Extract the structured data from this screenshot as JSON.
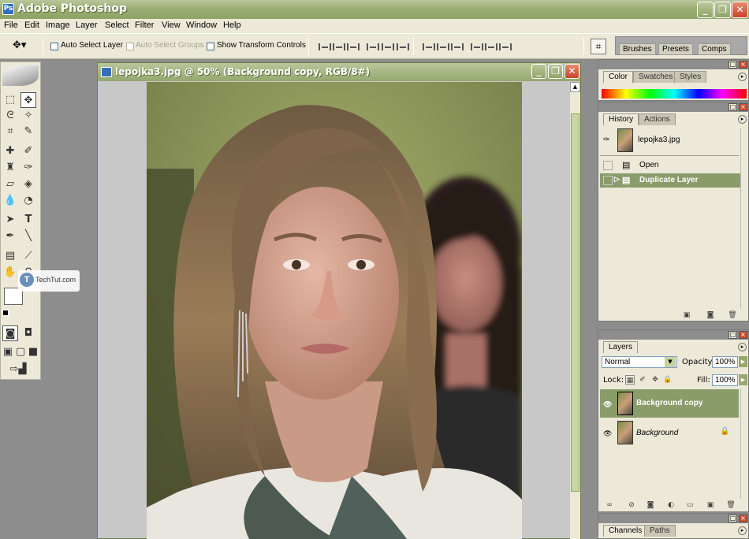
{
  "app": {
    "title": "Adobe Photoshop",
    "icon": "photoshop-app-icon",
    "window_buttons": [
      "_",
      "❐",
      "✕"
    ]
  },
  "menu": [
    "File",
    "Edit",
    "Image",
    "Layer",
    "Select",
    "Filter",
    "View",
    "Window",
    "Help"
  ],
  "options_bar": {
    "auto_select_layer": "Auto Select Layer",
    "auto_select_groups": "Auto Select Groups",
    "show_transform_controls": "Show Transform Controls",
    "palette_well_tabs": [
      "Brushes",
      "Presets",
      "Comps"
    ]
  },
  "watermark": {
    "logo_letter": "T",
    "text": "TechTut.com"
  },
  "document": {
    "title": "lepojka3.jpg @ 50% (Background copy, RGB/8#)"
  },
  "color_panel": {
    "tabs": [
      "Color",
      "Swatches",
      "Styles"
    ]
  },
  "history_panel": {
    "tabs": [
      "History",
      "Actions"
    ],
    "snapshot": "lepojka3.jpg",
    "items": [
      "Open",
      "Duplicate Layer"
    ]
  },
  "layers_panel": {
    "tabs": [
      "Layers"
    ],
    "blend_mode": "Normal",
    "opacity_label": "Opacity:",
    "opacity": "100%",
    "lock_label": "Lock:",
    "fill_label": "Fill:",
    "fill": "100%",
    "layers": [
      "Background copy",
      "Background"
    ]
  },
  "channels_panel": {
    "tabs": [
      "Channels",
      "Paths"
    ]
  },
  "colors": {
    "title_bar": "#98ab72",
    "selected_row": "#8a9c6a",
    "chrome": "#ece9d8"
  }
}
